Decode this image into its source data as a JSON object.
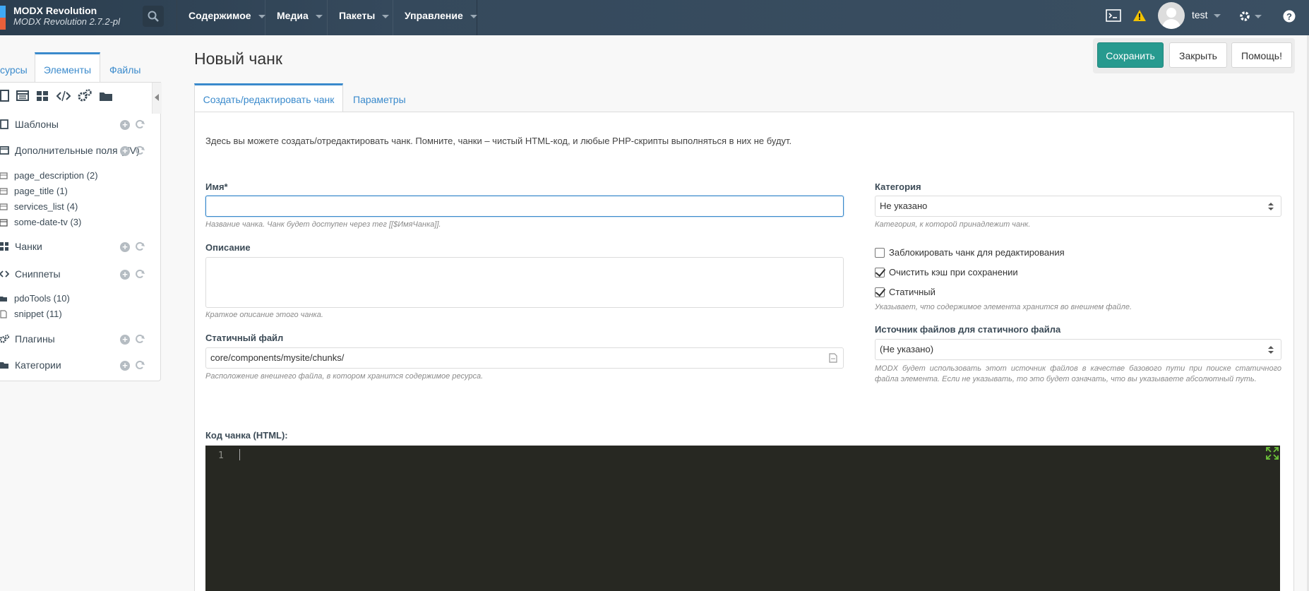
{
  "app": {
    "brand_name": "MODX Revolution",
    "brand_version": "MODX Revolution 2.7.2-pl",
    "user": "test"
  },
  "nav": {
    "items": [
      {
        "label": "Содержимое"
      },
      {
        "label": "Медиа"
      },
      {
        "label": "Пакеты"
      },
      {
        "label": "Управление"
      }
    ]
  },
  "left_tabs": {
    "resources": "сурсы",
    "elements": "Элементы",
    "files": "Файлы"
  },
  "tree": {
    "templates": "Шаблоны",
    "tvs": "Дополнительные поля (TV)",
    "tv_items": [
      {
        "label": "page_description (2)"
      },
      {
        "label": "page_title (1)"
      },
      {
        "label": "services_list (4)"
      },
      {
        "label": "some-date-tv (3)"
      }
    ],
    "chunks": "Чанки",
    "snippets": "Сниппеты",
    "snippet_items": [
      {
        "label": "pdoTools (10)"
      },
      {
        "label": "snippet (11)"
      }
    ],
    "plugins": "Плагины",
    "categories": "Категории"
  },
  "page": {
    "title": "Новый чанк"
  },
  "actions": {
    "save": "Сохранить",
    "close": "Закрыть",
    "help": "Помощь!"
  },
  "tabs": {
    "edit": "Создать/редактировать чанк",
    "params": "Параметры"
  },
  "form": {
    "intro": "Здесь вы можете создать/отредактировать чанк. Помните, чанки – чистый HTML-код, и любые PHP-скрипты выполняться в них не будут.",
    "name_label": "Имя*",
    "name_value": "",
    "name_help": "Название чанка. Чанк будет доступен через тег [[$ИмяЧанка]].",
    "desc_label": "Описание",
    "desc_value": "",
    "desc_help": "Краткое описание этого чанка.",
    "static_label": "Статичный файл",
    "static_value": "core/components/mysite/chunks/",
    "static_help": "Расположение внешнего файла, в котором хранится содержимое ресурса.",
    "category_label": "Категория",
    "category_value": "Не указано",
    "category_help": "Категория, к которой принадлежит чанк.",
    "lock_label": "Заблокировать чанк для редактирования",
    "lock_checked": false,
    "clear_cache_label": "Очистить кэш при сохранении",
    "clear_cache_checked": true,
    "static_cb_label": "Статичный",
    "static_cb_checked": true,
    "static_cb_help": "Указывает, что содержимое элемента хранится во внешнем файле.",
    "source_label": "Источник файлов для статичного файла",
    "source_value": "(Не указано)",
    "source_help": "MODX будет использовать этот источник файлов в качестве базового пути при поиске статичного файла элемента. Если не указывать, то это будет означать, что вы указываете абсолютный путь.",
    "code_label": "Код чанка (HTML):",
    "code_line_number": "1"
  },
  "colors": {
    "topbar": "#2b3e4f",
    "accent": "#3a8acc",
    "primary_button": "#279a8f",
    "editor_bg": "#272822"
  }
}
